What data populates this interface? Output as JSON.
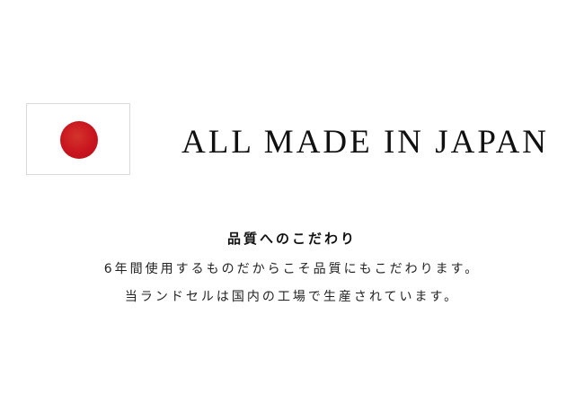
{
  "colors": {
    "background": "#ffffff",
    "text": "#111111",
    "flag_red": "#c8141e",
    "flag_border": "#d9d9d9"
  },
  "flag": {
    "icon": "japan-flag-icon"
  },
  "headline": "ALL MADE IN JAPAN",
  "subtitle": "品質へのこだわり",
  "body": {
    "line1": "6年間使用するものだからこそ品質にもこだわります。",
    "line2": "当ランドセルは国内の工場で生産されています。"
  }
}
